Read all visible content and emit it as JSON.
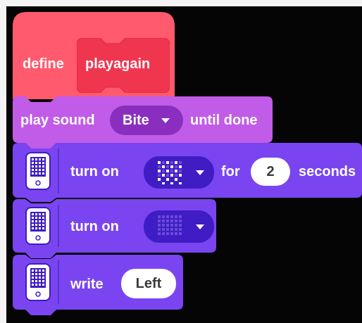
{
  "define_block": {
    "keyword": "define",
    "name": "playagain",
    "color": "#ff5a6e"
  },
  "sound_block": {
    "prefix": "play sound",
    "sound": "Bite",
    "suffix": "until done",
    "color": "#c05ce8"
  },
  "display_block_1": {
    "label": "turn on",
    "connector": "for",
    "duration": "2",
    "unit": "seconds",
    "icon": "device-icon",
    "pattern_icon": "checker-pattern-icon"
  },
  "display_block_2": {
    "label": "turn on",
    "icon": "device-icon",
    "pattern_icon": "grid-pattern-icon"
  },
  "write_block": {
    "label": "write",
    "value": "Left",
    "icon": "device-icon"
  },
  "colors": {
    "display_purple": "#7a45f0",
    "dropdown_dark": "#3f1cc4",
    "sound_dropdown": "#8a2ec0",
    "background": "#050505"
  }
}
